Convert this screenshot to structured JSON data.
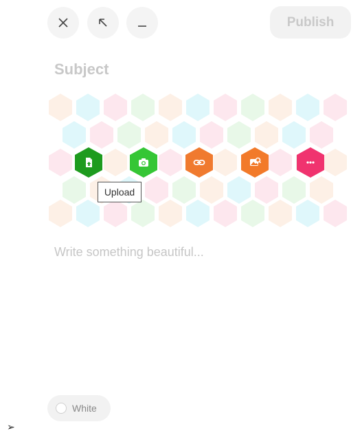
{
  "toolbar": {
    "close_icon": "close-icon",
    "expand_icon": "expand-arrow-icon",
    "minimize_icon": "minimize-icon",
    "publish_label": "Publish"
  },
  "composer": {
    "subject_placeholder": "Subject",
    "body_placeholder": "Write something beautiful..."
  },
  "actions": [
    {
      "name": "upload",
      "icon": "file-upload-icon",
      "color": "#1e9b1e"
    },
    {
      "name": "camera",
      "icon": "camera-icon",
      "color": "#35c635"
    },
    {
      "name": "link",
      "icon": "link-icon",
      "color": "#f07a2f"
    },
    {
      "name": "image-search",
      "icon": "image-search-icon",
      "color": "#f27a2a"
    },
    {
      "name": "more",
      "icon": "more-icon",
      "color": "#f0336f"
    }
  ],
  "tooltip": {
    "label": "Upload"
  },
  "bottom": {
    "toggle_label": "White"
  },
  "colors": {
    "hex_pink": "#fde7ee",
    "hex_cyan": "#dff7fb",
    "hex_green": "#e8f8e8",
    "hex_peach": "#fdf0e6"
  },
  "bullet": "➢"
}
